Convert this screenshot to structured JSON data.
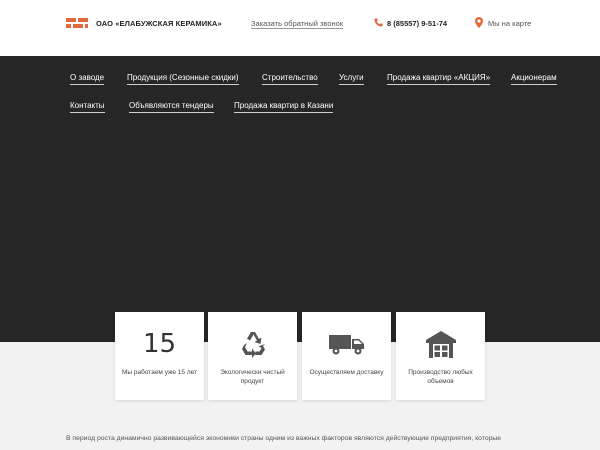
{
  "header": {
    "company_name": "ОАО «ЕЛАБУЖСКАЯ КЕРАМИКА»",
    "callback_link": "Заказать обратный звонок",
    "phone": "8 (85557) 9-51-74",
    "map_link": "Мы на карте",
    "icons": [
      "brick-logo-icon",
      "phone-icon",
      "map-pin-icon"
    ],
    "accent_color": "#e06a3b"
  },
  "nav": {
    "items": [
      "О заводе",
      "Продукция (Сезонные скидки)",
      "Строительство",
      "Услуги",
      "Продажа квартир «АКЦИЯ»",
      "Акционерам",
      "Контакты",
      "Объявляются тендеры",
      "Продажа квартир в Казани"
    ]
  },
  "features": [
    {
      "value": "15",
      "label": "Мы работаем уже 15 лет"
    },
    {
      "icon": "recycle-icon",
      "label": "Экологически чистый продукт"
    },
    {
      "icon": "delivery-truck-icon",
      "label": "Осуществляем доставку"
    },
    {
      "icon": "warehouse-icon",
      "label": "Производство любых объемов"
    }
  ],
  "intro": {
    "text": "В период роста динамично развивающейся экономики страны одним из важных факторов являются действующие предприятия, которые"
  }
}
